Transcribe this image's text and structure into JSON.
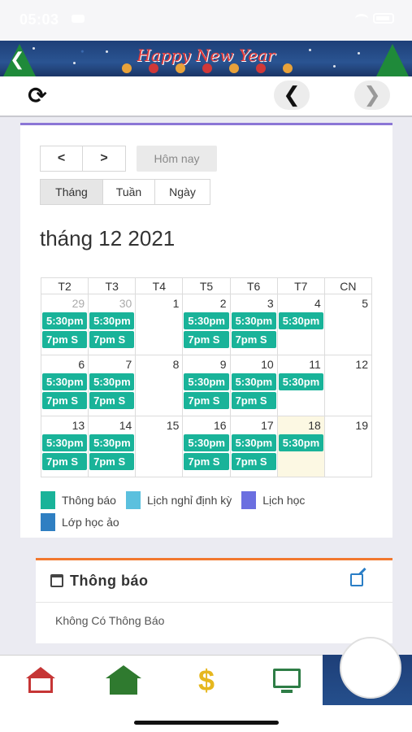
{
  "status_bar": {
    "time": "05:03"
  },
  "banner": {
    "title": "Happy New Year",
    "back_icon": "chevron-left-icon"
  },
  "toolbar": {
    "refresh_icon": "refresh-icon",
    "prev_icon": "chevron-left-icon",
    "next_icon": "chevron-right-icon"
  },
  "calendar": {
    "nav_prev": "<",
    "nav_next": ">",
    "today_label": "Hôm nay",
    "views": [
      "Tháng",
      "Tuần",
      "Ngày"
    ],
    "month_title": "tháng 12 2021",
    "weekdays": [
      "T2",
      "T3",
      "T4",
      "T5",
      "T6",
      "T7",
      "CN"
    ],
    "weeks": [
      [
        {
          "day": "29",
          "other": true,
          "events": [
            "5:30pm",
            "7pm S"
          ]
        },
        {
          "day": "30",
          "other": true,
          "events": [
            "5:30pm",
            "7pm S"
          ]
        },
        {
          "day": "1",
          "events": []
        },
        {
          "day": "2",
          "events": [
            "5:30pm",
            "7pm S"
          ]
        },
        {
          "day": "3",
          "events": [
            "5:30pm",
            "7pm S"
          ]
        },
        {
          "day": "4",
          "events": [
            "5:30pm"
          ]
        },
        {
          "day": "5",
          "events": []
        }
      ],
      [
        {
          "day": "6",
          "events": [
            "5:30pm",
            "7pm S"
          ]
        },
        {
          "day": "7",
          "events": [
            "5:30pm",
            "7pm S"
          ]
        },
        {
          "day": "8",
          "events": []
        },
        {
          "day": "9",
          "events": [
            "5:30pm",
            "7pm S"
          ]
        },
        {
          "day": "10",
          "events": [
            "5:30pm",
            "7pm S"
          ]
        },
        {
          "day": "11",
          "events": [
            "5:30pm"
          ]
        },
        {
          "day": "12",
          "events": []
        }
      ],
      [
        {
          "day": "13",
          "events": [
            "5:30pm",
            "7pm S"
          ]
        },
        {
          "day": "14",
          "events": [
            "5:30pm",
            "7pm S"
          ]
        },
        {
          "day": "15",
          "events": []
        },
        {
          "day": "16",
          "events": [
            "5:30pm",
            "7pm S"
          ]
        },
        {
          "day": "17",
          "events": [
            "5:30pm",
            "7pm S"
          ]
        },
        {
          "day": "18",
          "today": true,
          "events": [
            "5:30pm"
          ]
        },
        {
          "day": "19",
          "events": []
        }
      ]
    ],
    "event_color": "#19b399",
    "today_color": "#fcf8e3",
    "legend": [
      {
        "label": "Thông báo",
        "color": "#19b399"
      },
      {
        "label": "Lịch nghỉ định kỳ",
        "color": "#5bc0de"
      },
      {
        "label": "Lịch học",
        "color": "#6b6fe0"
      },
      {
        "label": "Lớp học ảo",
        "color": "#2f7fc2"
      }
    ]
  },
  "notice": {
    "title": "Thông báo",
    "empty_text": "Không Có Thông Báo",
    "accent": "#f2782e"
  },
  "bottom_nav": {
    "items": [
      "home-icon",
      "school-home-icon",
      "dollar-icon",
      "online-class-icon"
    ]
  }
}
